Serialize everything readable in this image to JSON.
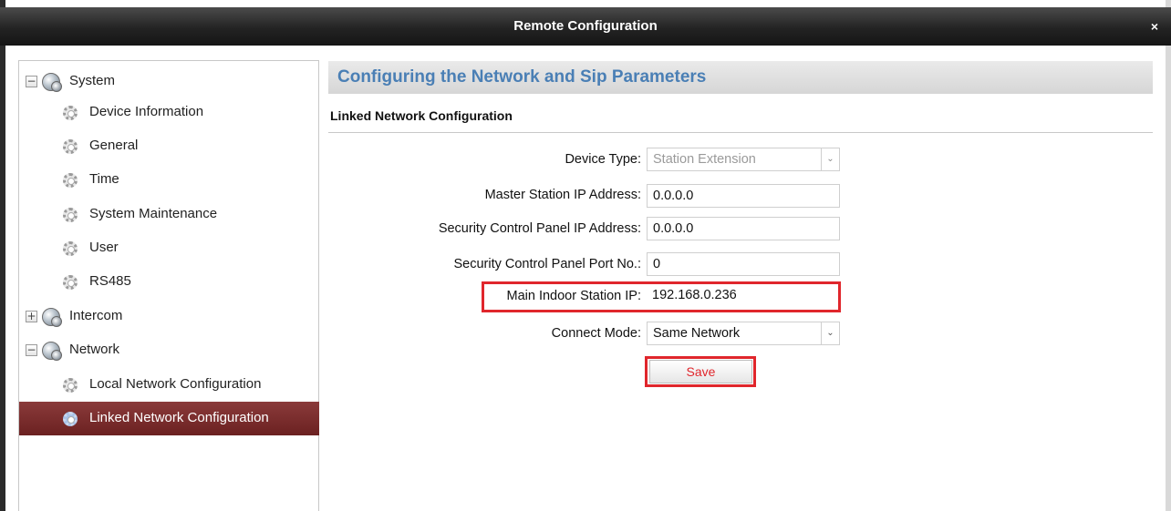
{
  "window": {
    "title": "Remote Configuration",
    "close_glyph": "×"
  },
  "tree": {
    "system": {
      "label": "System",
      "expander": "−",
      "children": [
        "Device Information",
        "General",
        "Time",
        "System Maintenance",
        "User",
        "RS485"
      ]
    },
    "intercom": {
      "label": "Intercom",
      "expander": "+"
    },
    "network": {
      "label": "Network",
      "expander": "−",
      "children": [
        "Local Network Configuration",
        "Linked Network Configuration"
      ],
      "selected": "Linked Network Configuration"
    }
  },
  "main": {
    "header": "Configuring the Network and Sip Parameters",
    "subheader": "Linked Network Configuration",
    "fields": {
      "device_type": {
        "label": "Device Type:",
        "value": "Station Extension",
        "disabled": true
      },
      "master_ip": {
        "label": "Master Station IP Address:",
        "value": "0.0.0.0"
      },
      "security_ip": {
        "label": "Security Control Panel IP Address:",
        "value": "0.0.0.0"
      },
      "security_port": {
        "label": "Security Control Panel Port No.:",
        "value": "0"
      },
      "main_indoor_ip": {
        "label": "Main Indoor Station IP:",
        "value": "192.168.0.236"
      },
      "connect_mode": {
        "label": "Connect Mode:",
        "value": "Same Network"
      }
    },
    "save_label": "Save"
  },
  "colors": {
    "highlight": "#e0262c",
    "selected_row": "#7a2b2b",
    "header_text": "#4a7fb5"
  },
  "icons": {
    "dropdown": "chevron-down-icon",
    "tree_group": "globe-icon",
    "tree_leaf": "gear-icon"
  }
}
